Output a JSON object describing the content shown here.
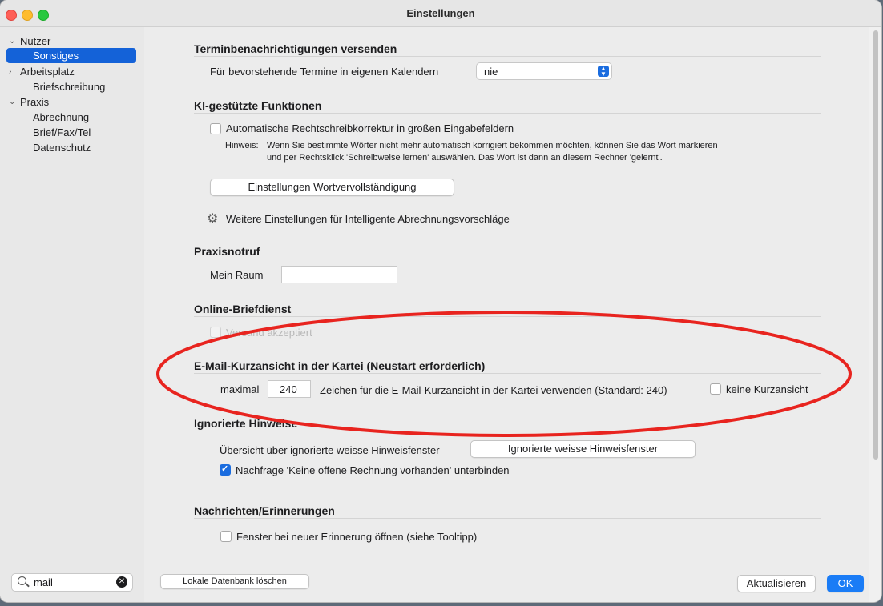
{
  "window": {
    "title": "Einstellungen"
  },
  "sidebar": {
    "items": [
      {
        "label": "Nutzer",
        "group": true
      },
      {
        "label": "Sonstiges",
        "selected": true
      },
      {
        "label": "Arbeitsplatz",
        "group": true
      },
      {
        "label": "Briefschreibung"
      },
      {
        "label": "Praxis",
        "group": true
      },
      {
        "label": "Abrechnung"
      },
      {
        "label": "Brief/Fax/Tel"
      },
      {
        "label": "Datenschutz"
      }
    ],
    "search": {
      "value": "mail"
    }
  },
  "sections": {
    "termine": {
      "title": "Terminbenachrichtigungen versenden",
      "row_label": "Für bevorstehende Termine in eigenen Kalendern",
      "select_value": "nie"
    },
    "ki": {
      "title": "KI-gestützte Funktionen",
      "checkbox_label": "Automatische Rechtschreibkorrektur in großen Eingabefeldern",
      "hint_label": "Hinweis:",
      "hint_line1": "Wenn Sie bestimmte Wörter nicht mehr automatisch korrigiert bekommen möchten, können Sie das Wort markieren",
      "hint_line2": "und per Rechtsklick 'Schreibweise lernen' auswählen. Das Wort ist dann an diesem Rechner 'gelernt'.",
      "button_label": "Einstellungen Wortvervollständigung",
      "more_settings": "Weitere Einstellungen für Intelligente Abrechnungsvorschläge"
    },
    "notruf": {
      "title": "Praxisnotruf",
      "room_label": "Mein Raum",
      "room_value": ""
    },
    "brief": {
      "title": "Online-Briefdienst",
      "checkbox_label": "Versand akzeptiert"
    },
    "email": {
      "title": "E-Mail-Kurzansicht in der Kartei (Neustart erforderlich)",
      "max_label": "maximal",
      "max_value": "240",
      "desc": "Zeichen für die E-Mail-Kurzansicht in der Kartei verwenden (Standard: 240)",
      "no_preview_label": "keine Kurzansicht"
    },
    "ignored": {
      "title": "Ignorierte Hinweise",
      "overview_label": "Übersicht über ignorierte weisse Hinweisfenster",
      "button_label": "Ignorierte weisse Hinweisfenster",
      "checkbox_label": "Nachfrage 'Keine offene Rechnung vorhanden' unterbinden"
    },
    "reminders": {
      "title": "Nachrichten/Erinnerungen",
      "checkbox_label": "Fenster bei neuer Erinnerung öffnen (siehe Tooltipp)"
    }
  },
  "footer": {
    "delete_db": "Lokale Datenbank löschen",
    "refresh": "Aktualisieren",
    "ok": "OK"
  },
  "colors": {
    "accent": "#1a7cf6",
    "selection": "#1462d8",
    "highlight_ellipse": "#e8241f"
  }
}
